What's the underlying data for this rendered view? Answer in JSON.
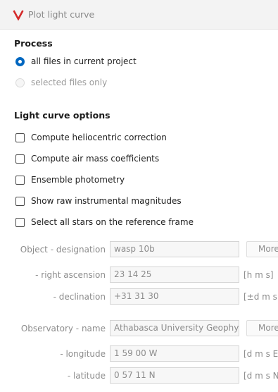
{
  "window": {
    "title": "Plot light curve",
    "accent_color": "#d42a2a"
  },
  "process": {
    "heading": "Process",
    "options": [
      {
        "label": "all files in current project",
        "selected": true,
        "enabled": true
      },
      {
        "label": "selected files only",
        "selected": false,
        "enabled": false
      }
    ]
  },
  "options": {
    "heading": "Light curve options",
    "checks": [
      {
        "label": "Compute heliocentric correction",
        "checked": false
      },
      {
        "label": "Compute air mass coefficients",
        "checked": false
      },
      {
        "label": "Ensemble photometry",
        "checked": false
      },
      {
        "label": "Show raw instrumental magnitudes",
        "checked": false
      },
      {
        "label": "Select all stars on the reference frame",
        "checked": false
      }
    ]
  },
  "object": {
    "designation_label": "Object - designation",
    "designation_value": "wasp 10b",
    "more_label": "More",
    "ra_label": "- right ascension",
    "ra_value": "23 14 25",
    "ra_unit": "[h m s]",
    "dec_label": "- declination",
    "dec_value": "+31 31 30",
    "dec_unit": "[±d m s"
  },
  "observatory": {
    "name_label": "Observatory - name",
    "name_value": "Athabasca University Geophy",
    "more_label": "More",
    "lon_label": "- longitude",
    "lon_value": "1 59 00 W",
    "lon_unit": "[d m s E",
    "lat_label": "- latitude",
    "lat_value": "0 57 11 N",
    "lat_unit": "[d m s N"
  }
}
